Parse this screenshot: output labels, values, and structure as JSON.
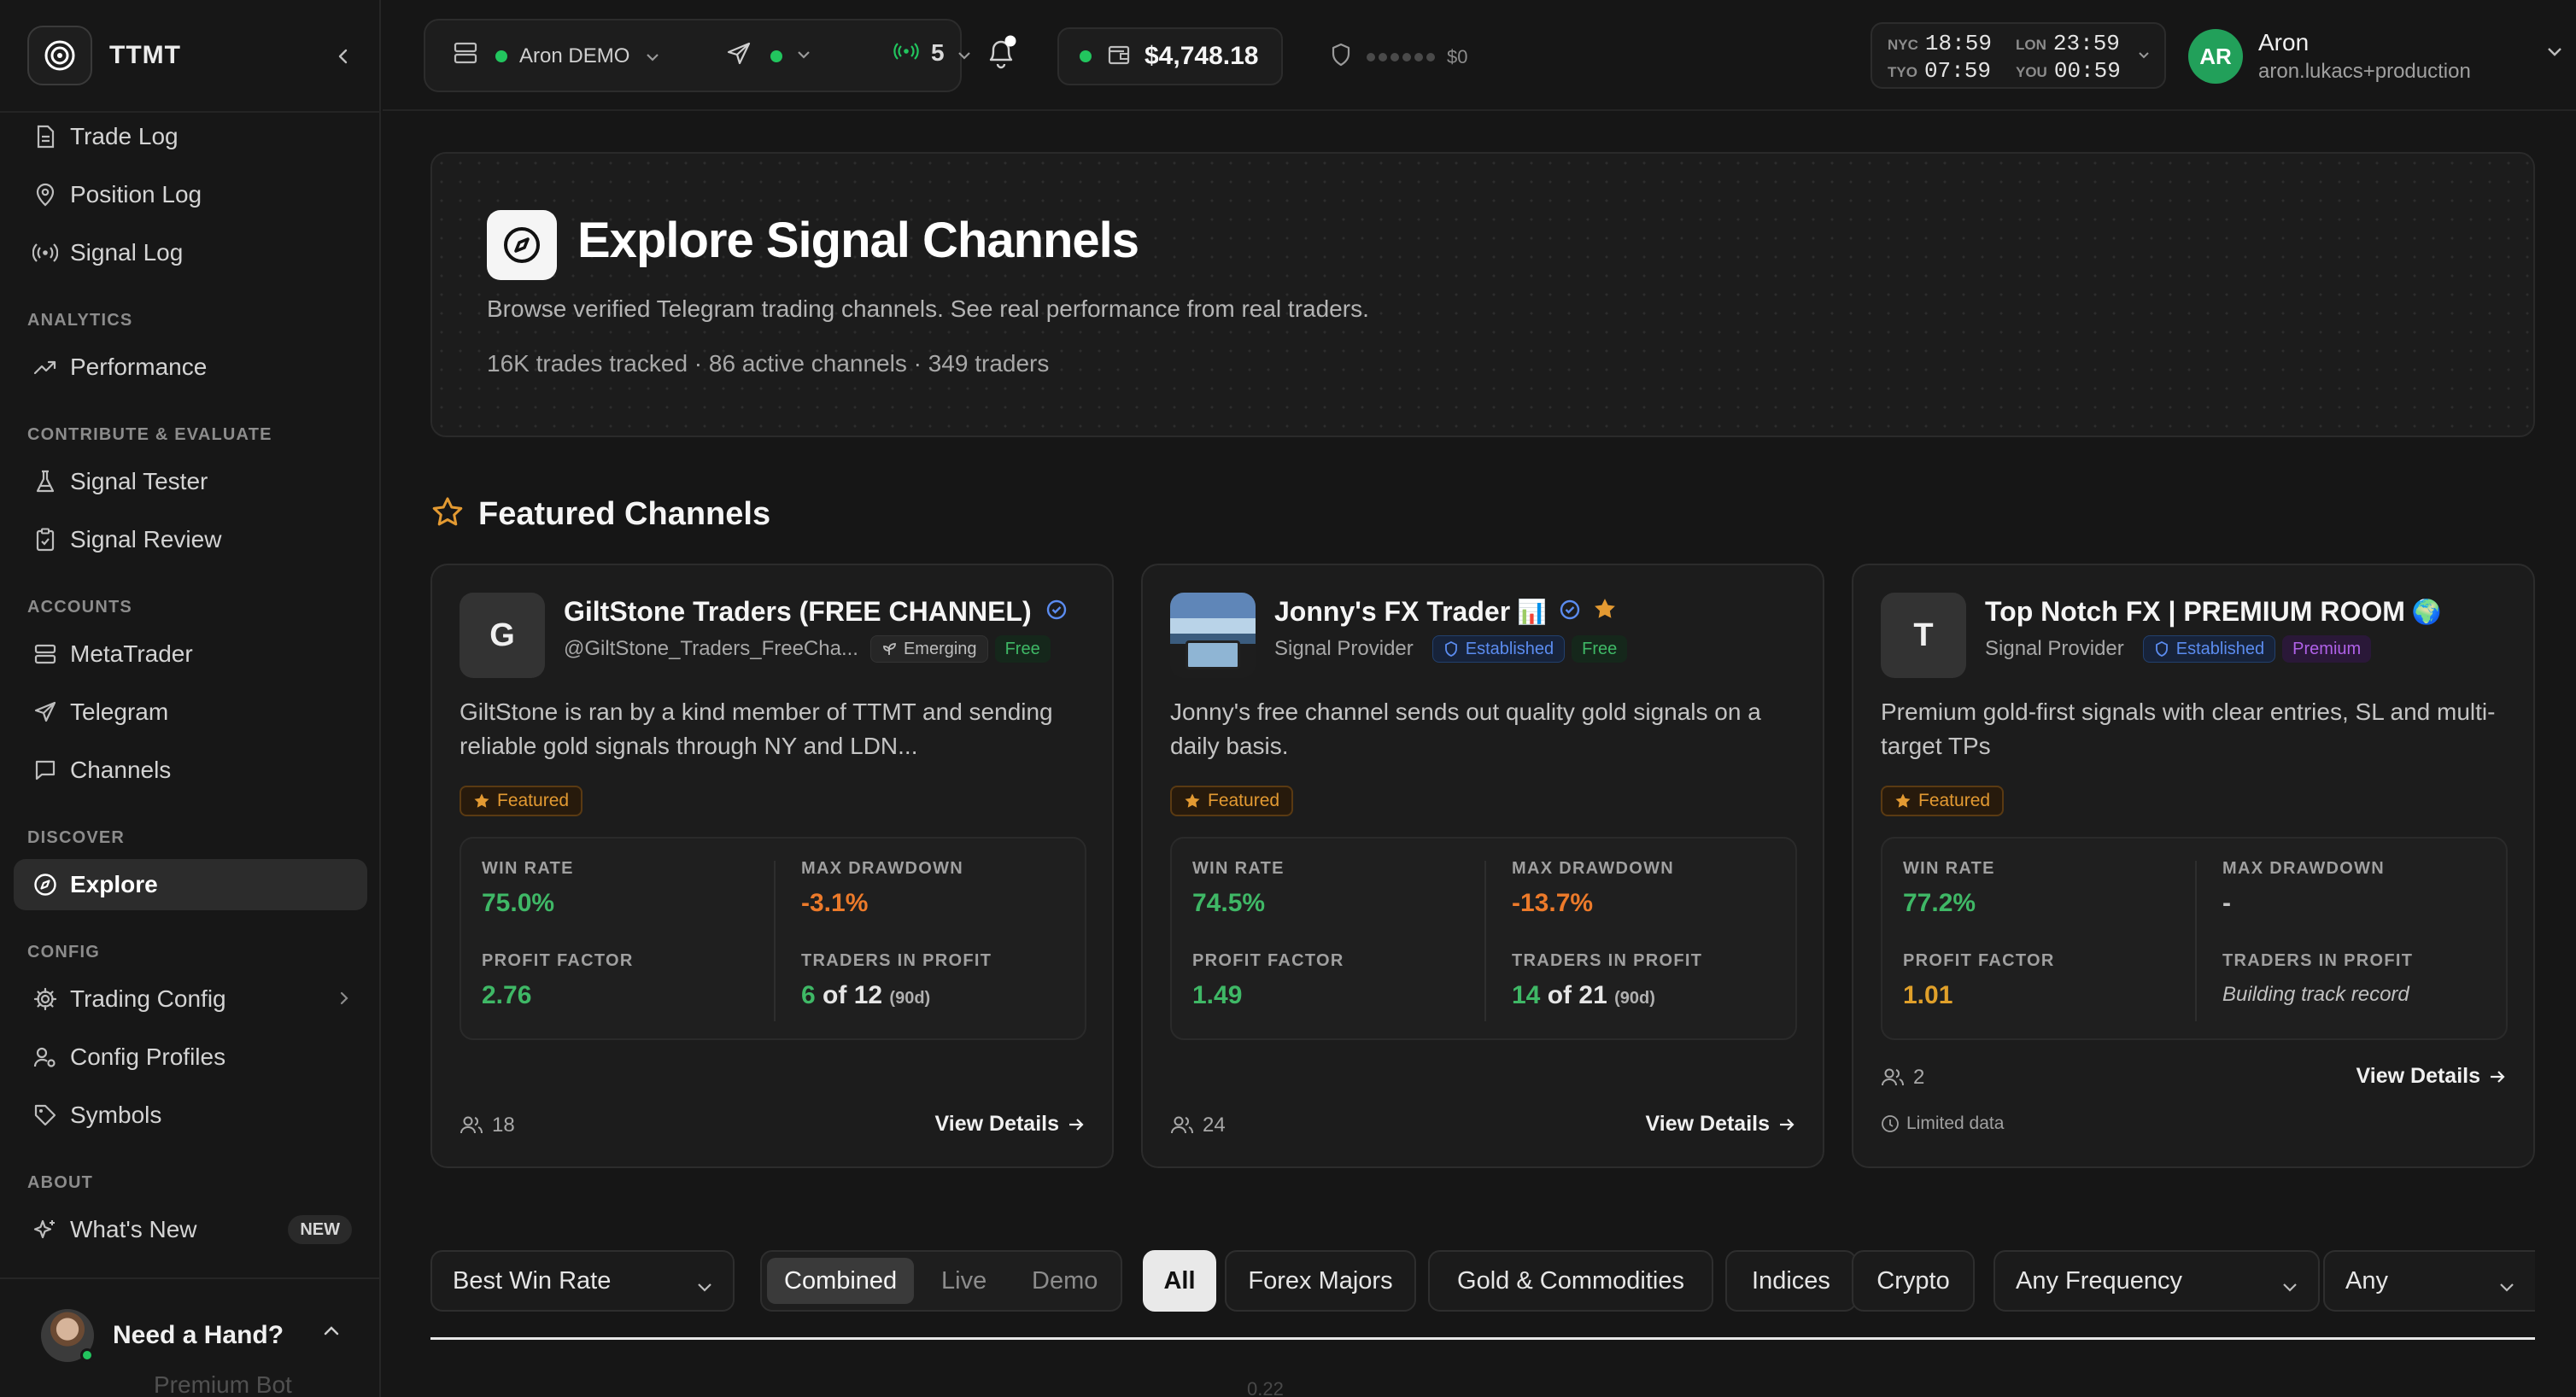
{
  "sidebar": {
    "brand": "TTMT",
    "items_top": [
      {
        "label": "Trade Log",
        "icon": "file-text-icon"
      },
      {
        "label": "Position Log",
        "icon": "map-pin-icon"
      },
      {
        "label": "Signal Log",
        "icon": "broadcast-icon"
      }
    ],
    "sections": {
      "analytics": "ANALYTICS",
      "contribute": "CONTRIBUTE & EVALUATE",
      "accounts": "ACCOUNTS",
      "discover": "DISCOVER",
      "config": "CONFIG",
      "about": "ABOUT"
    },
    "performance": "Performance",
    "signal_tester": "Signal Tester",
    "signal_review": "Signal Review",
    "metatrader": "MetaTrader",
    "telegram": "Telegram",
    "channels": "Channels",
    "explore": "Explore",
    "trading_config": "Trading Config",
    "config_profiles": "Config Profiles",
    "symbols": "Symbols",
    "whats_new": "What's New",
    "whats_new_badge": "NEW",
    "help": "Need a Hand?"
  },
  "topbar": {
    "account": "Aron DEMO",
    "signal_count": "5",
    "balance": "$4,748.18",
    "risk_value": "$0",
    "clocks": {
      "nyc_label": "NYC",
      "nyc_time": "18:59",
      "lon_label": "LON",
      "lon_time": "23:59",
      "tyo_label": "TYO",
      "tyo_time": "07:59",
      "you_label": "YOU",
      "you_time": "00:59"
    },
    "user": {
      "initials": "AR",
      "name": "Aron",
      "email": "aron.lukacs+production"
    }
  },
  "hero": {
    "title": "Explore Signal Channels",
    "subtitle": "Browse verified Telegram trading channels. See real performance from real traders.",
    "stats": "16K trades tracked · 86 active channels · 349 traders"
  },
  "featured": {
    "heading": "Featured Channels",
    "badge": "Featured",
    "labels": {
      "win_rate": "WIN RATE",
      "max_drawdown": "MAX DRAWDOWN",
      "profit_factor": "PROFIT FACTOR",
      "traders_in_profit": "TRADERS IN PROFIT",
      "of": "of",
      "period": "(90d)",
      "view_details": "View Details"
    },
    "cards": [
      {
        "avatar": "G",
        "name": "GiltStone Traders (FREE CHANNEL)",
        "handle": "@GiltStone_Traders_FreeCha...",
        "tier": "Emerging",
        "price": "Free",
        "description": "GiltStone is ran by a kind member of TTMT and sending reliable gold signals through NY and LDN...",
        "win_rate": "75.0%",
        "max_drawdown": "-3.1%",
        "profit_factor": "2.76",
        "traders_profit": "6",
        "traders_total": "12",
        "members": "18"
      },
      {
        "avatar": "",
        "name": "Jonny's FX Trader",
        "emoji": "📊",
        "handle": "Signal Provider",
        "tier": "Established",
        "price": "Free",
        "description": "Jonny's free channel sends out quality gold signals on a daily basis.",
        "win_rate": "74.5%",
        "max_drawdown": "-13.7%",
        "profit_factor": "1.49",
        "traders_profit": "14",
        "traders_total": "21",
        "members": "24"
      },
      {
        "avatar": "T",
        "name": "Top Notch FX | PREMIUM ROOM",
        "emoji": "🌍",
        "handle": "Signal Provider",
        "tier": "Established",
        "price": "Premium",
        "description": "Premium gold-first signals with clear entries, SL and multi-target TPs",
        "win_rate": "77.2%",
        "max_drawdown": "-",
        "profit_factor": "1.01",
        "traders_note": "Building track record",
        "members": "2",
        "limited": "Limited data"
      }
    ]
  },
  "filters": {
    "sort": "Best Win Rate",
    "modes": [
      "Combined",
      "Live",
      "Demo"
    ],
    "categories": [
      "All",
      "Forex Majors",
      "Gold & Commodities",
      "Indices",
      "Crypto"
    ],
    "frequency": "Any Frequency",
    "any": "Any"
  },
  "ghost_row": {
    "text": "Premium Bot",
    "value": "0.22"
  },
  "colors": {
    "accent_green": "#3fb866",
    "drawdown_orange": "#ec7a2a",
    "featured_amber": "#e39a32",
    "established_blue": "#5b8cf0",
    "premium_purple": "#b061e8"
  }
}
